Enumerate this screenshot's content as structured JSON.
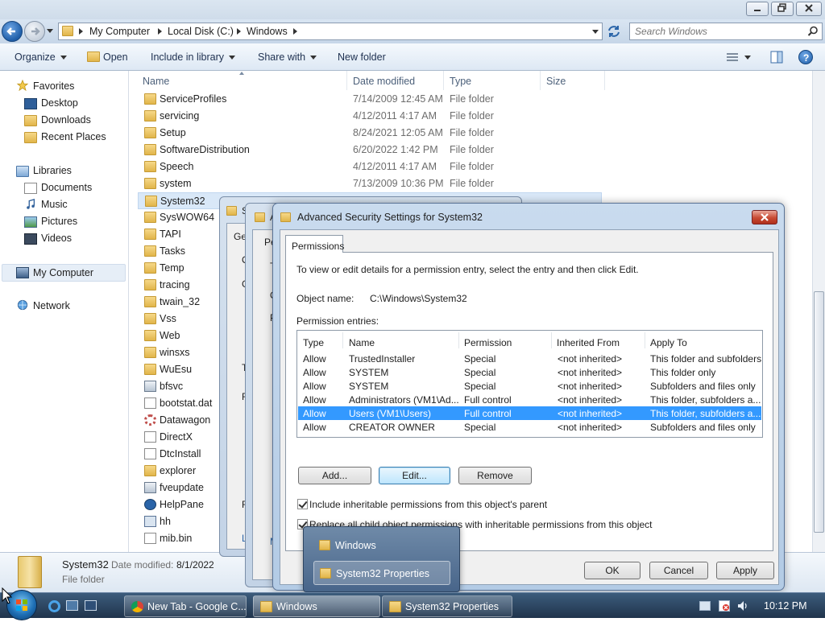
{
  "explorer": {
    "breadcrumb": [
      "My Computer",
      "Local Disk (C:)",
      "Windows"
    ],
    "search_placeholder": "Search Windows",
    "toolbar": {
      "organize": "Organize",
      "open": "Open",
      "include_in_library": "Include in library",
      "share_with": "Share with",
      "new_folder": "New folder"
    },
    "nav": {
      "favorites": "Favorites",
      "desktop": "Desktop",
      "downloads": "Downloads",
      "recent_places": "Recent Places",
      "libraries": "Libraries",
      "documents": "Documents",
      "music": "Music",
      "pictures": "Pictures",
      "videos": "Videos",
      "my_computer": "My Computer",
      "network": "Network"
    },
    "columns": {
      "name": "Name",
      "date": "Date modified",
      "type": "Type",
      "size": "Size"
    },
    "files": [
      {
        "name": "ServiceProfiles",
        "date": "7/14/2009 12:45 AM",
        "type": "File folder"
      },
      {
        "name": "servicing",
        "date": "4/12/2011 4:17 AM",
        "type": "File folder"
      },
      {
        "name": "Setup",
        "date": "8/24/2021 12:05 AM",
        "type": "File folder"
      },
      {
        "name": "SoftwareDistribution",
        "date": "6/20/2022 1:42 PM",
        "type": "File folder"
      },
      {
        "name": "Speech",
        "date": "4/12/2011 4:17 AM",
        "type": "File folder"
      },
      {
        "name": "system",
        "date": "7/13/2009 10:36 PM",
        "type": "File folder"
      },
      {
        "name": "System32",
        "date": "",
        "type": ""
      },
      {
        "name": "SysWOW64",
        "date": "",
        "type": ""
      },
      {
        "name": "TAPI",
        "date": "",
        "type": ""
      },
      {
        "name": "Tasks",
        "date": "",
        "type": ""
      },
      {
        "name": "Temp",
        "date": "",
        "type": ""
      },
      {
        "name": "tracing",
        "date": "",
        "type": ""
      },
      {
        "name": "twain_32",
        "date": "",
        "type": ""
      },
      {
        "name": "Vss",
        "date": "",
        "type": ""
      },
      {
        "name": "Web",
        "date": "",
        "type": ""
      },
      {
        "name": "winsxs",
        "date": "",
        "type": ""
      },
      {
        "name": "WuEsu",
        "date": "",
        "type": ""
      },
      {
        "name": "bfsvc",
        "date": "",
        "type": ""
      },
      {
        "name": "bootstat.dat",
        "date": "",
        "type": ""
      },
      {
        "name": "Datawagon",
        "date": "",
        "type": ""
      },
      {
        "name": "DirectX",
        "date": "",
        "type": ""
      },
      {
        "name": "DtcInstall",
        "date": "",
        "type": ""
      },
      {
        "name": "explorer",
        "date": "",
        "type": ""
      },
      {
        "name": "fveupdate",
        "date": "",
        "type": ""
      },
      {
        "name": "HelpPane",
        "date": "",
        "type": ""
      },
      {
        "name": "hh",
        "date": "",
        "type": ""
      },
      {
        "name": "mib.bin",
        "date": "",
        "type": ""
      }
    ],
    "details": {
      "name": "System32",
      "date_label": "Date modified:",
      "date_value": "8/1/2022",
      "type": "File folder"
    }
  },
  "bg_dialogs": {
    "props_title_fragment": "S",
    "props_tab_fragment": "Ge",
    "mid_title_fragment": "A",
    "mid_tab_fragment": "Pe",
    "props_letters": [
      "O",
      "G",
      "T",
      "F",
      "F",
      "L"
    ],
    "mid_letters": [
      "T",
      "O",
      "P",
      "M"
    ]
  },
  "advanced": {
    "title": "Advanced Security Settings for System32",
    "tab": "Permissions",
    "intro": "To view or edit details for a permission entry, select the entry and then click Edit.",
    "object_label": "Object name:",
    "object_value": "C:\\Windows\\System32",
    "entries_label": "Permission entries:",
    "headers": {
      "type": "Type",
      "name": "Name",
      "permission": "Permission",
      "inherited": "Inherited From",
      "apply": "Apply To"
    },
    "entries": [
      {
        "type": "Allow",
        "name": "TrustedInstaller",
        "permission": "Special",
        "inherited": "<not inherited>",
        "apply": "This folder and subfolders"
      },
      {
        "type": "Allow",
        "name": "SYSTEM",
        "permission": "Special",
        "inherited": "<not inherited>",
        "apply": "This folder only"
      },
      {
        "type": "Allow",
        "name": "SYSTEM",
        "permission": "Special",
        "inherited": "<not inherited>",
        "apply": "Subfolders and files only"
      },
      {
        "type": "Allow",
        "name": "Administrators (VM1\\Ad...",
        "permission": "Full control",
        "inherited": "<not inherited>",
        "apply": "This folder, subfolders a..."
      },
      {
        "type": "Allow",
        "name": "Users (VM1\\Users)",
        "permission": "Full control",
        "inherited": "<not inherited>",
        "apply": "This folder, subfolders a..."
      },
      {
        "type": "Allow",
        "name": "CREATOR OWNER",
        "permission": "Special",
        "inherited": "<not inherited>",
        "apply": "Subfolders and files only"
      }
    ],
    "selected_index": 4,
    "buttons": {
      "add": "Add...",
      "edit": "Edit...",
      "remove": "Remove",
      "ok": "OK",
      "cancel": "Cancel",
      "apply": "Apply"
    },
    "include_inheritable": "Include inheritable permissions from this object's parent",
    "replace_child": "Replace all child object permissions with inheritable permissions from this object",
    "include_checked": true,
    "replace_checked": true
  },
  "popup": {
    "items": [
      "Windows",
      "System32 Properties"
    ]
  },
  "taskbar": {
    "items": [
      "New Tab - Google C...",
      "Windows",
      "System32 Properties"
    ],
    "clock": "10:12 PM"
  },
  "colors": {
    "selection": "#3399ff",
    "folder": "#e1b54a",
    "accent": "#1f5ea8"
  }
}
